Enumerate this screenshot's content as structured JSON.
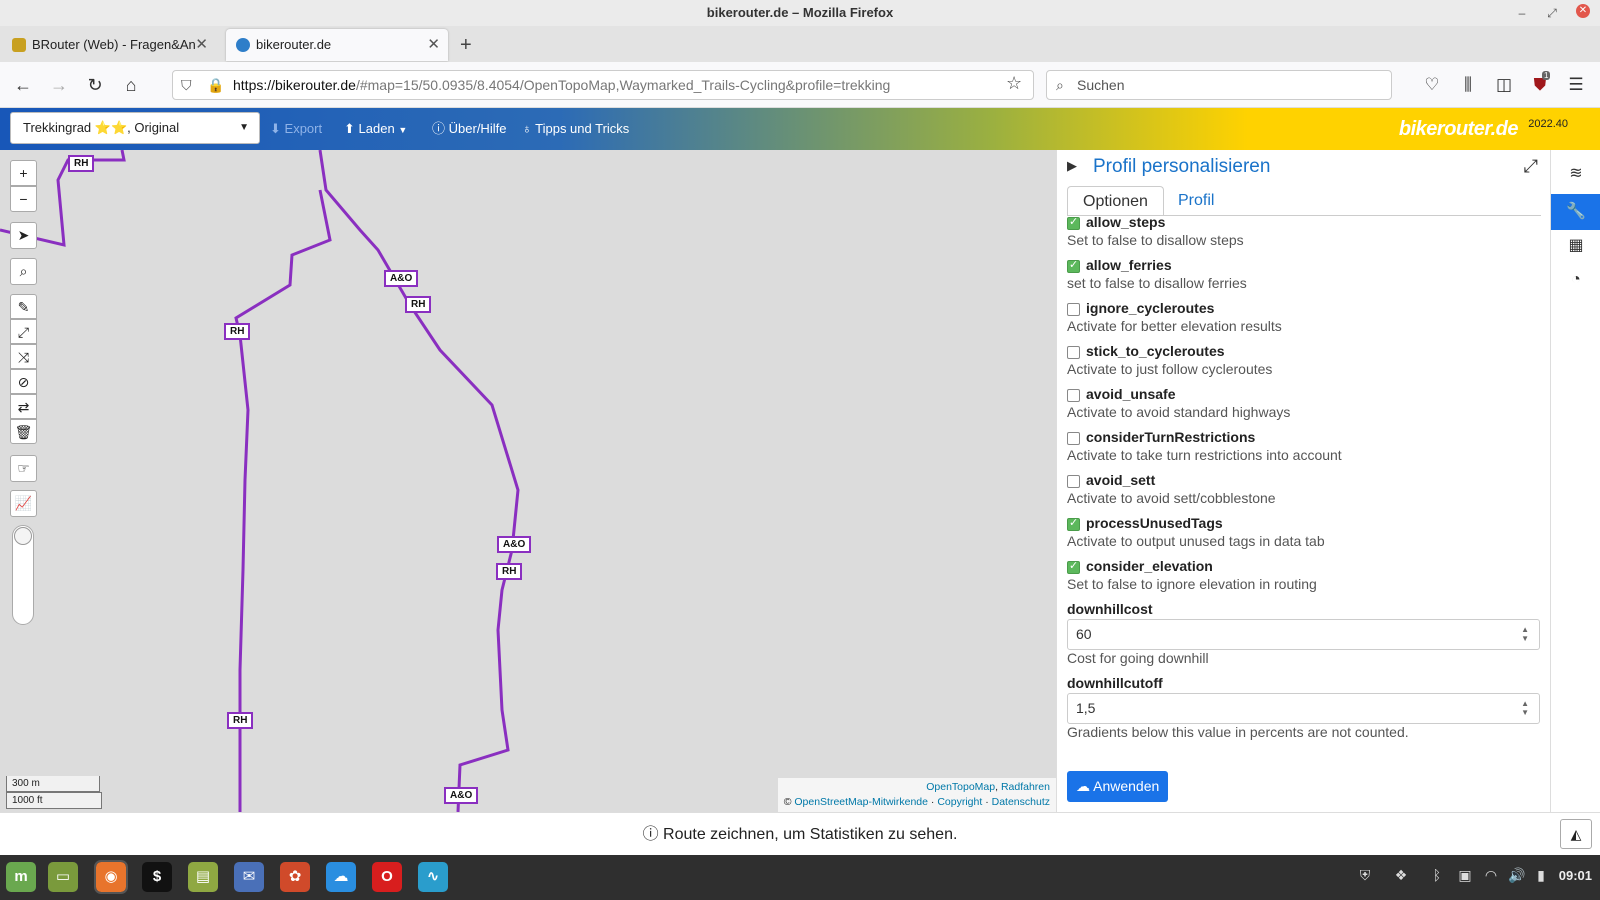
{
  "window": {
    "title": "bikerouter.de – Mozilla Firefox"
  },
  "tabs": [
    {
      "label": "BRouter (Web) - Fragen&An"
    },
    {
      "label": "bikerouter.de"
    }
  ],
  "nav": {
    "url_domain": "https://bikerouter.de",
    "url_rest": "/#map=15/50.0935/8.4054/OpenTopoMap,Waymarked_Trails-Cycling&profile=trekking",
    "search_placeholder": "Suchen",
    "badge": "1"
  },
  "toolbar": {
    "profile": "Trekkingrad ⭐⭐, Original",
    "export": "Export",
    "load": "Laden",
    "about": "Über/Hilfe",
    "tips": "Tipps und Tricks",
    "brand": "bikerouter.de",
    "version": "2022.40"
  },
  "map": {
    "trail_labels": [
      "RH",
      "A&O",
      "RH",
      "RH",
      "A&O",
      "RH",
      "RH",
      "A&O"
    ],
    "scale_metric": "300 m",
    "scale_imperial": "1000 ft",
    "attribution_line1_a": "OpenTopoMap",
    "attribution_line1_b": "Radfahren",
    "attribution_line2_a": "OpenStreetMap-Mitwirkende",
    "attribution_line2_b": "Copyright",
    "attribution_line2_c": "Datenschutz",
    "trail_color": "#8a2fc0"
  },
  "panel": {
    "title": "Profil personalisieren",
    "tabs": [
      "Optionen",
      "Profil"
    ],
    "options": [
      {
        "name": "allow_steps",
        "desc": "Set to false to disallow steps",
        "checked": true
      },
      {
        "name": "allow_ferries",
        "desc": "set to false to disallow ferries",
        "checked": true
      },
      {
        "name": "ignore_cycleroutes",
        "desc": "Activate for better elevation results",
        "checked": false
      },
      {
        "name": "stick_to_cycleroutes",
        "desc": "Activate to just follow cycleroutes",
        "checked": false
      },
      {
        "name": "avoid_unsafe",
        "desc": "Activate to avoid standard highways",
        "checked": false
      },
      {
        "name": "considerTurnRestrictions",
        "desc": "Activate to take turn restrictions into account",
        "checked": false
      },
      {
        "name": "avoid_sett",
        "desc": "Activate to avoid sett/cobblestone",
        "checked": false
      },
      {
        "name": "processUnusedTags",
        "desc": "Activate to output unused tags in data tab",
        "checked": true
      },
      {
        "name": "consider_elevation",
        "desc": "Set to false to ignore elevation in routing",
        "checked": true
      }
    ],
    "downhillcost": {
      "label": "downhillcost",
      "value": "60",
      "hint": "Cost for going downhill"
    },
    "downhillcutoff": {
      "label": "downhillcutoff",
      "value": "1,5",
      "hint": "Gradients below this value in percents are not counted."
    },
    "apply": "Anwenden"
  },
  "status": {
    "text": "Route zeichnen, um Statistiken zu sehen."
  },
  "taskbar": {
    "clock": "09:01"
  }
}
